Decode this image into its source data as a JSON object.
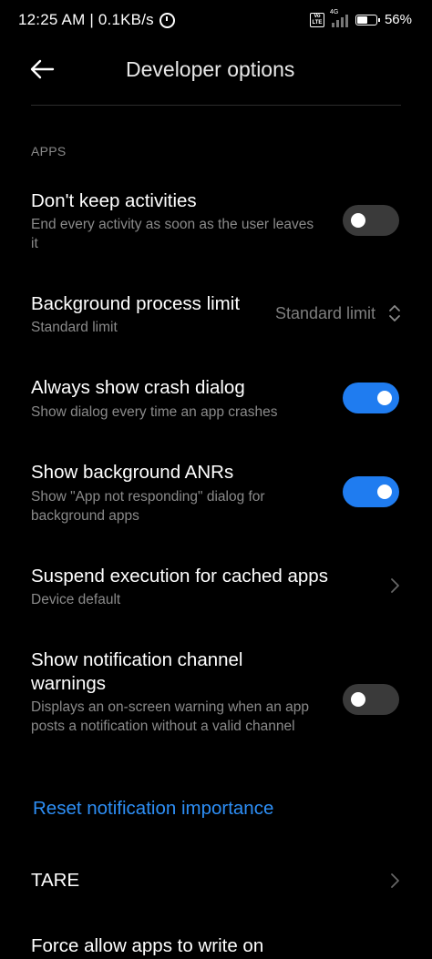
{
  "status_bar": {
    "time_speed": "12:25 AM | 0.1KB/s",
    "network": "4G",
    "volte": "Vo LTE",
    "battery": "56%"
  },
  "header": {
    "title": "Developer options"
  },
  "section": {
    "label": "APPS"
  },
  "settings": {
    "dont_keep_activities": {
      "title": "Don't keep activities",
      "subtitle": "End every activity as soon as the user leaves it",
      "enabled": false
    },
    "background_process_limit": {
      "title": "Background process limit",
      "subtitle": "Standard limit",
      "value": "Standard limit"
    },
    "always_show_crash_dialog": {
      "title": "Always show crash dialog",
      "subtitle": "Show dialog every time an app crashes",
      "enabled": true
    },
    "show_background_anrs": {
      "title": "Show background ANRs",
      "subtitle": "Show \"App not responding\" dialog for background apps",
      "enabled": true
    },
    "suspend_execution": {
      "title": "Suspend execution for cached apps",
      "subtitle": "Device default"
    },
    "notification_channel_warnings": {
      "title": "Show notification channel warnings",
      "subtitle": "Displays an on-screen warning when an app posts a notification without a valid channel",
      "enabled": false
    },
    "reset_notification_importance": {
      "label": "Reset notification importance"
    },
    "tare": {
      "title": "TARE"
    },
    "force_allow_apps": {
      "title": "Force allow apps to write on"
    }
  },
  "colors": {
    "background": "#000000",
    "accent": "#1f7cf0",
    "link": "#2d8ef5",
    "secondary_text": "#8a8a8a"
  }
}
